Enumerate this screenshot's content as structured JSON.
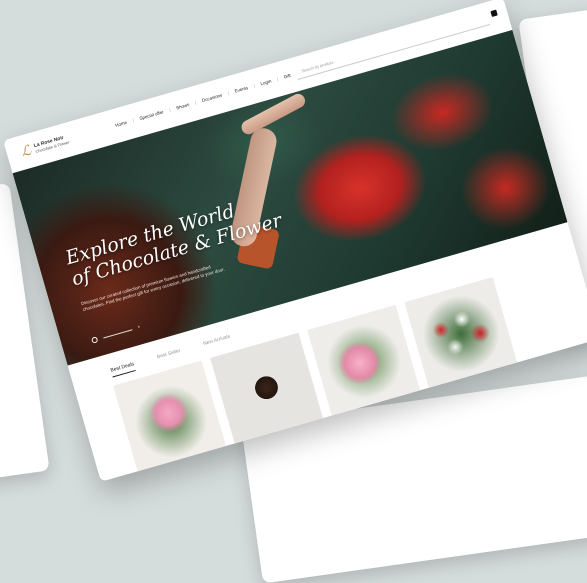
{
  "brand": {
    "name": "La Rose Noir",
    "tagline": "Chocolate & Flower"
  },
  "nav": {
    "items": [
      "Home",
      "Special offer",
      "Shows",
      "Occasions",
      "Events",
      "Login",
      "Gift"
    ],
    "search_placeholder": "Search by product..."
  },
  "hero": {
    "title": "Explore the World\nof Chocolate & Flower",
    "description": "Discover our curated collection of premium flowers and handcrafted chocolates. Find the perfect gift for every occasion, delivered to your door."
  },
  "tabs": [
    "Best Deals",
    "Best Seller",
    "New Arrivals"
  ],
  "products": [
    {
      "name": "Pink rose bouquet"
    },
    {
      "name": "Chocolate box"
    },
    {
      "name": "Pink hydrangea arrangement"
    },
    {
      "name": "Red and white roses"
    }
  ],
  "colors": {
    "accent": "#b6924a",
    "hero_red": "#c92822",
    "hero_green": "#2d4b40"
  }
}
